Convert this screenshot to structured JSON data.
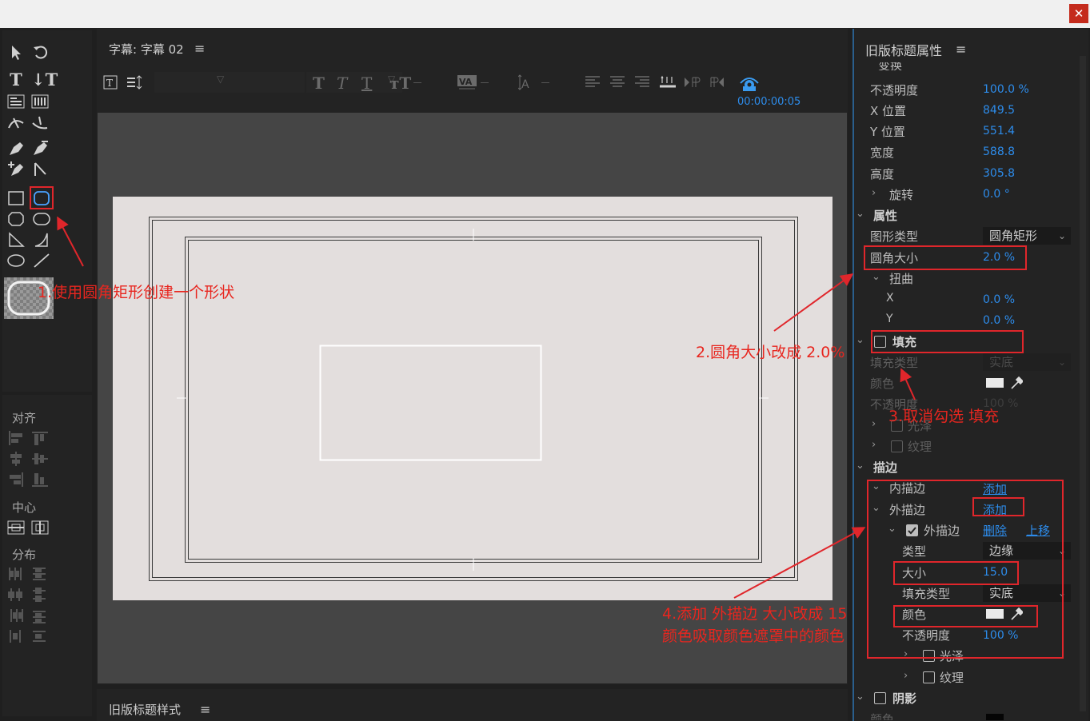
{
  "window": {
    "close_glyph": "✕"
  },
  "tools_panel": {
    "sections": {
      "align": "对齐",
      "center": "中心",
      "distribute": "分布"
    }
  },
  "title_panel": {
    "title": "字幕: 字幕 02",
    "menu_glyph": "≡",
    "timecode": "00:00:00:05"
  },
  "styles_panel": {
    "title": "旧版标题样式",
    "menu_glyph": "≡"
  },
  "properties_panel": {
    "title": "旧版标题属性",
    "menu_glyph": "≡",
    "transform_section": "变换",
    "opacity_label": "不透明度",
    "opacity_value": "100.0 %",
    "x_label": "X 位置",
    "x_value": "849.5",
    "y_label": "Y 位置",
    "y_value": "551.4",
    "width_label": "宽度",
    "width_value": "588.8",
    "height_label": "高度",
    "height_value": "305.8",
    "rotation_label": "旋转",
    "rotation_value": "0.0 °",
    "attributes_section": "属性",
    "shape_type_label": "图形类型",
    "shape_type_value": "圆角矩形",
    "corner_size_label": "圆角大小",
    "corner_size_value": "2.0 %",
    "distort_label": "扭曲",
    "distort_x_label": "X",
    "distort_x_value": "0.0 %",
    "distort_y_label": "Y",
    "distort_y_value": "0.0 %",
    "fill_label": "填充",
    "fill_type_label": "填充类型",
    "fill_type_value": "实底",
    "fill_color_label": "颜色",
    "fill_opacity_label": "不透明度",
    "fill_opacity_value": "100 %",
    "sheen_label": "光泽",
    "texture_label": "纹理",
    "strokes_section": "描边",
    "inner_stroke_label": "内描边",
    "inner_stroke_add": "添加",
    "outer_stroke_label": "外描边",
    "outer_stroke_add": "添加",
    "outer_stroke_item_label": "外描边",
    "delete_label": "删除",
    "move_up_label": "上移",
    "stroke_type_label": "类型",
    "stroke_type_value": "边缘",
    "stroke_size_label": "大小",
    "stroke_size_value": "15.0",
    "stroke_fill_type_label": "填充类型",
    "stroke_fill_type_value": "实底",
    "stroke_color_label": "颜色",
    "stroke_opacity_label": "不透明度",
    "stroke_opacity_value": "100 %",
    "stroke_sheen_label": "光泽",
    "stroke_texture_label": "纹理",
    "shadow_label": "阴影",
    "shadow_color_label": "颜色"
  },
  "annotations": {
    "step1": "1.使用圆角矩形创建一个形状",
    "step2": "2.圆角大小改成 2.0%",
    "step3": "3.取消勾选 填充",
    "step4_line1": "4.添加 外描边 大小改成 15",
    "step4_line2": "颜色吸取颜色遮罩中的颜色"
  },
  "colors": {
    "accent_blue": "#2d8ceb",
    "annotation_red": "#e0262b"
  }
}
